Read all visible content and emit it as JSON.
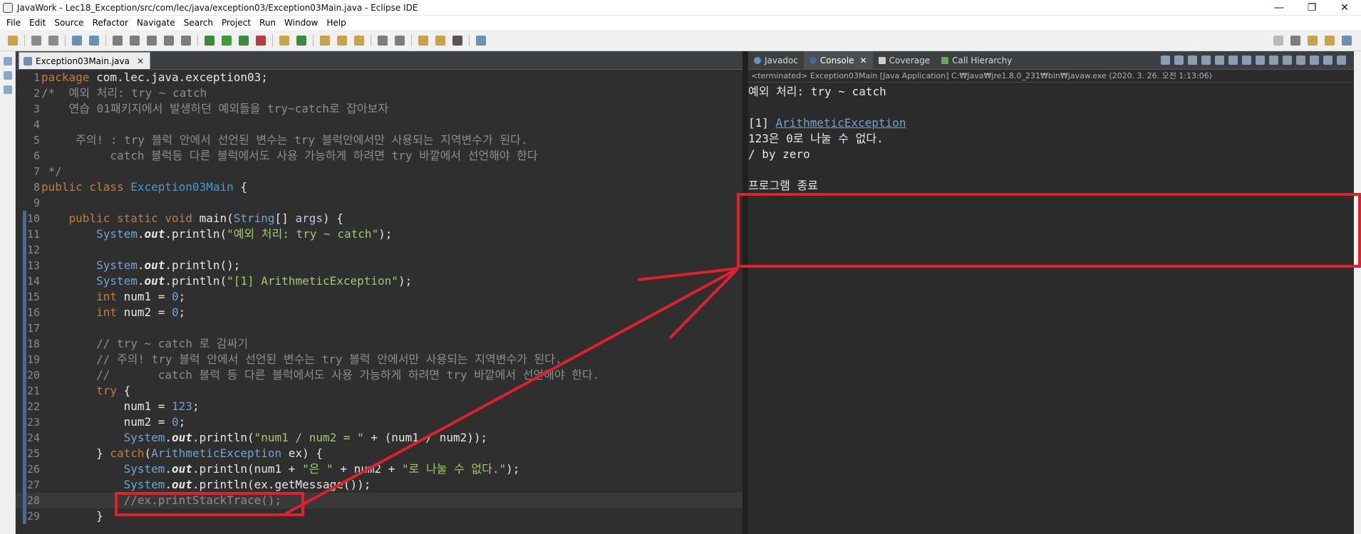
{
  "window": {
    "title": "JavaWork - Lec18_Exception/src/com/lec/java/exception03/Exception03Main.java - Eclipse IDE",
    "minimize": "—",
    "restore": "❐",
    "close": "✕"
  },
  "menu": [
    "File",
    "Edit",
    "Source",
    "Refactor",
    "Navigate",
    "Search",
    "Project",
    "Run",
    "Window",
    "Help"
  ],
  "editor": {
    "tab_label": "Exception03Main.java",
    "tab_close": "✕",
    "lines": [
      {
        "n": "1",
        "segs": [
          [
            "kw",
            "package"
          ],
          [
            "code",
            " com.lec.java.exception03;"
          ]
        ]
      },
      {
        "n": "2",
        "segs": [
          [
            "cmt",
            "/*  예외 처리: try ~ catch"
          ]
        ]
      },
      {
        "n": "3",
        "segs": [
          [
            "cmt",
            "    연습 01패키지에서 발생하던 예외들을 try~catch로 잡아보자"
          ]
        ]
      },
      {
        "n": "4",
        "segs": [
          [
            "cmt",
            ""
          ]
        ]
      },
      {
        "n": "5",
        "segs": [
          [
            "cmt",
            "     주의! : try 블럭 안에서 선언된 변수는 try 블럭안에서만 사용되는 지역변수가 된다."
          ]
        ]
      },
      {
        "n": "6",
        "segs": [
          [
            "cmt",
            "          catch 블럭등 다른 블럭에서도 사용 가능하게 하려면 try 바깥에서 선언해야 한다"
          ]
        ]
      },
      {
        "n": "7",
        "segs": [
          [
            "cmt",
            " */"
          ]
        ]
      },
      {
        "n": "8",
        "segs": [
          [
            "kw",
            "public class "
          ],
          [
            "cls",
            "Exception03Main"
          ],
          [
            "code",
            " {"
          ]
        ]
      },
      {
        "n": "9",
        "segs": [
          [
            "code",
            ""
          ]
        ]
      },
      {
        "n": "10",
        "segs": [
          [
            "code",
            "    "
          ],
          [
            "kw",
            "public static void "
          ],
          [
            "code",
            "main("
          ],
          [
            "ty",
            "String"
          ],
          [
            "code",
            "[] "
          ],
          [
            "var",
            "args"
          ],
          [
            "code",
            ") {"
          ]
        ]
      },
      {
        "n": "11",
        "segs": [
          [
            "code",
            "        "
          ],
          [
            "ty",
            "System"
          ],
          [
            "code",
            "."
          ],
          [
            "fld",
            "out"
          ],
          [
            "code",
            ".println("
          ],
          [
            "str2",
            "\"예외 처리: try ~ catch\""
          ],
          [
            "code",
            ");"
          ]
        ]
      },
      {
        "n": "12",
        "segs": [
          [
            "code",
            ""
          ]
        ]
      },
      {
        "n": "13",
        "segs": [
          [
            "code",
            "        "
          ],
          [
            "ty",
            "System"
          ],
          [
            "code",
            "."
          ],
          [
            "fld",
            "out"
          ],
          [
            "code",
            ".println();"
          ]
        ]
      },
      {
        "n": "14",
        "segs": [
          [
            "code",
            "        "
          ],
          [
            "ty",
            "System"
          ],
          [
            "code",
            "."
          ],
          [
            "fld",
            "out"
          ],
          [
            "code",
            ".println("
          ],
          [
            "str2",
            "\"[1] ArithmeticException\""
          ],
          [
            "code",
            ");"
          ]
        ]
      },
      {
        "n": "15",
        "segs": [
          [
            "code",
            "        "
          ],
          [
            "kw",
            "int "
          ],
          [
            "code",
            "num1 = "
          ],
          [
            "num",
            "0"
          ],
          [
            "code",
            ";"
          ]
        ]
      },
      {
        "n": "16",
        "segs": [
          [
            "code",
            "        "
          ],
          [
            "kw",
            "int "
          ],
          [
            "code",
            "num2 = "
          ],
          [
            "num",
            "0"
          ],
          [
            "code",
            ";"
          ]
        ]
      },
      {
        "n": "17",
        "segs": [
          [
            "code",
            ""
          ]
        ]
      },
      {
        "n": "18",
        "segs": [
          [
            "cmt",
            "        // try ~ catch 로 감싸기"
          ]
        ]
      },
      {
        "n": "19",
        "segs": [
          [
            "cmt",
            "        // 주의! try 블럭 안에서 선언된 변수는 try 블럭 안에서만 사용되는 지역변수가 된다."
          ]
        ]
      },
      {
        "n": "20",
        "segs": [
          [
            "cmt",
            "        //       catch 블럭 등 다른 블럭에서도 사용 가능하게 하려면 try 바깥에서 선언해야 한다."
          ]
        ]
      },
      {
        "n": "21",
        "segs": [
          [
            "code",
            "        "
          ],
          [
            "kw",
            "try"
          ],
          [
            "code",
            " {"
          ]
        ]
      },
      {
        "n": "22",
        "segs": [
          [
            "code",
            "            num1 = "
          ],
          [
            "num",
            "123"
          ],
          [
            "code",
            ";"
          ]
        ]
      },
      {
        "n": "23",
        "segs": [
          [
            "code",
            "            num2 = "
          ],
          [
            "num",
            "0"
          ],
          [
            "code",
            ";"
          ]
        ]
      },
      {
        "n": "24",
        "segs": [
          [
            "code",
            "            "
          ],
          [
            "ty",
            "System"
          ],
          [
            "code",
            "."
          ],
          [
            "fld",
            "out"
          ],
          [
            "code",
            ".println("
          ],
          [
            "str2",
            "\"num1 / num2 = \""
          ],
          [
            "code",
            " + (num1 / num2));"
          ]
        ]
      },
      {
        "n": "25",
        "segs": [
          [
            "code",
            "        } "
          ],
          [
            "kw",
            "catch"
          ],
          [
            "code",
            "("
          ],
          [
            "ty",
            "ArithmeticException"
          ],
          [
            "code",
            " ex) {"
          ]
        ]
      },
      {
        "n": "26",
        "segs": [
          [
            "code",
            "            "
          ],
          [
            "ty",
            "System"
          ],
          [
            "code",
            "."
          ],
          [
            "fld",
            "out"
          ],
          [
            "code",
            ".println(num1 + "
          ],
          [
            "str2",
            "\"은 \""
          ],
          [
            "code",
            " + num2 + "
          ],
          [
            "str2",
            "\"로 나눌 수 없다.\""
          ],
          [
            "code",
            ");"
          ]
        ]
      },
      {
        "n": "27",
        "segs": [
          [
            "code",
            "            "
          ],
          [
            "ty",
            "System"
          ],
          [
            "code",
            "."
          ],
          [
            "fld",
            "out"
          ],
          [
            "code",
            ".println(ex.getMessage());"
          ]
        ]
      },
      {
        "n": "28",
        "segs": [
          [
            "cmt",
            "            //ex.printStackTrace();"
          ]
        ]
      },
      {
        "n": "29",
        "segs": [
          [
            "code",
            "        }"
          ]
        ]
      }
    ]
  },
  "console": {
    "tabs": [
      {
        "label": "Javadoc"
      },
      {
        "label": "Console"
      },
      {
        "label": "Coverage"
      },
      {
        "label": "Call Hierarchy"
      }
    ],
    "console_close": "✕",
    "status": "<terminated> Exception03Main [Java Application] C:₩Java₩jre1.8.0_231₩bin₩javaw.exe (2020. 3. 26. 오전 1:13:06)",
    "output": {
      "line1": "예외 처리: try ~ catch",
      "line2": "",
      "line3_prefix": "[1] ",
      "line3_link": "ArithmeticException",
      "line4": "123은 0로 나눌 수 없다.",
      "line5": "/ by zero",
      "line6": "",
      "line7": "프로그램 종료"
    }
  },
  "colors": {
    "annotation": "#e0202a"
  }
}
